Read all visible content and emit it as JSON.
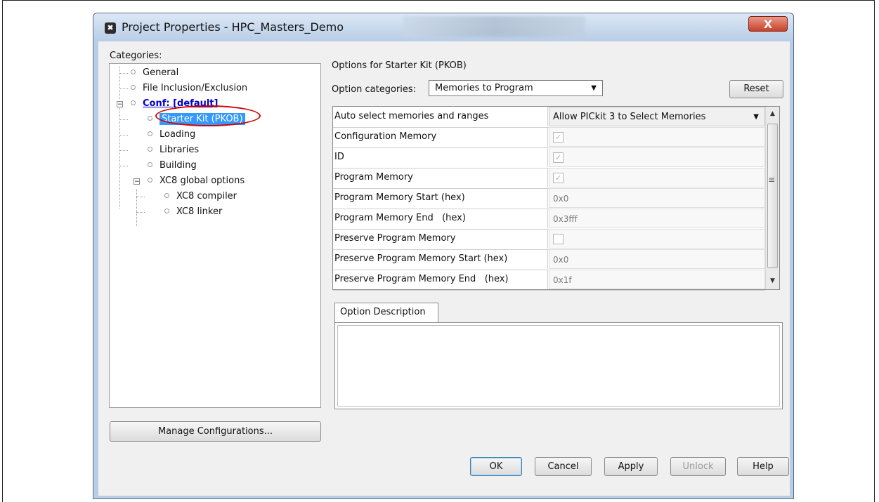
{
  "window": {
    "title": "Project Properties - HPC_Masters_Demo",
    "close_label": "X"
  },
  "categories": {
    "label": "Categories:",
    "items": [
      {
        "label": "General"
      },
      {
        "label": "File Inclusion/Exclusion"
      },
      {
        "label": "Conf: [default]"
      },
      {
        "label": "Starter Kit (PKOB)"
      },
      {
        "label": "Loading"
      },
      {
        "label": "Libraries"
      },
      {
        "label": "Building"
      },
      {
        "label": "XC8 global options"
      },
      {
        "label": "XC8 compiler"
      },
      {
        "label": "XC8 linker"
      }
    ],
    "selected": "Starter Kit (PKOB)"
  },
  "manage_button": "Manage Configurations...",
  "options": {
    "heading": "Options for Starter Kit (PKOB)",
    "category_label": "Option categories:",
    "category_value": "Memories to Program",
    "reset_label": "Reset",
    "rows": [
      {
        "name": "Auto select memories and ranges",
        "value": "Allow PICkit 3 to Select Memories"
      },
      {
        "name": "Configuration Memory",
        "value": "checked"
      },
      {
        "name": "ID",
        "value": "checked"
      },
      {
        "name": "Program Memory",
        "value": "checked"
      },
      {
        "name": "Program Memory Start (hex)",
        "value": "0x0"
      },
      {
        "name": "Program Memory End   (hex)",
        "value": "0x3fff"
      },
      {
        "name": "Preserve Program Memory",
        "value": "unchecked"
      },
      {
        "name": "Preserve Program Memory Start (hex)",
        "value": "0x0"
      },
      {
        "name": "Preserve Program Memory End   (hex)",
        "value": "0x1f"
      }
    ],
    "description_tab": "Option Description",
    "description_text": ""
  },
  "buttons": {
    "ok": "OK",
    "cancel": "Cancel",
    "apply": "Apply",
    "unlock": "Unlock",
    "help": "Help"
  }
}
